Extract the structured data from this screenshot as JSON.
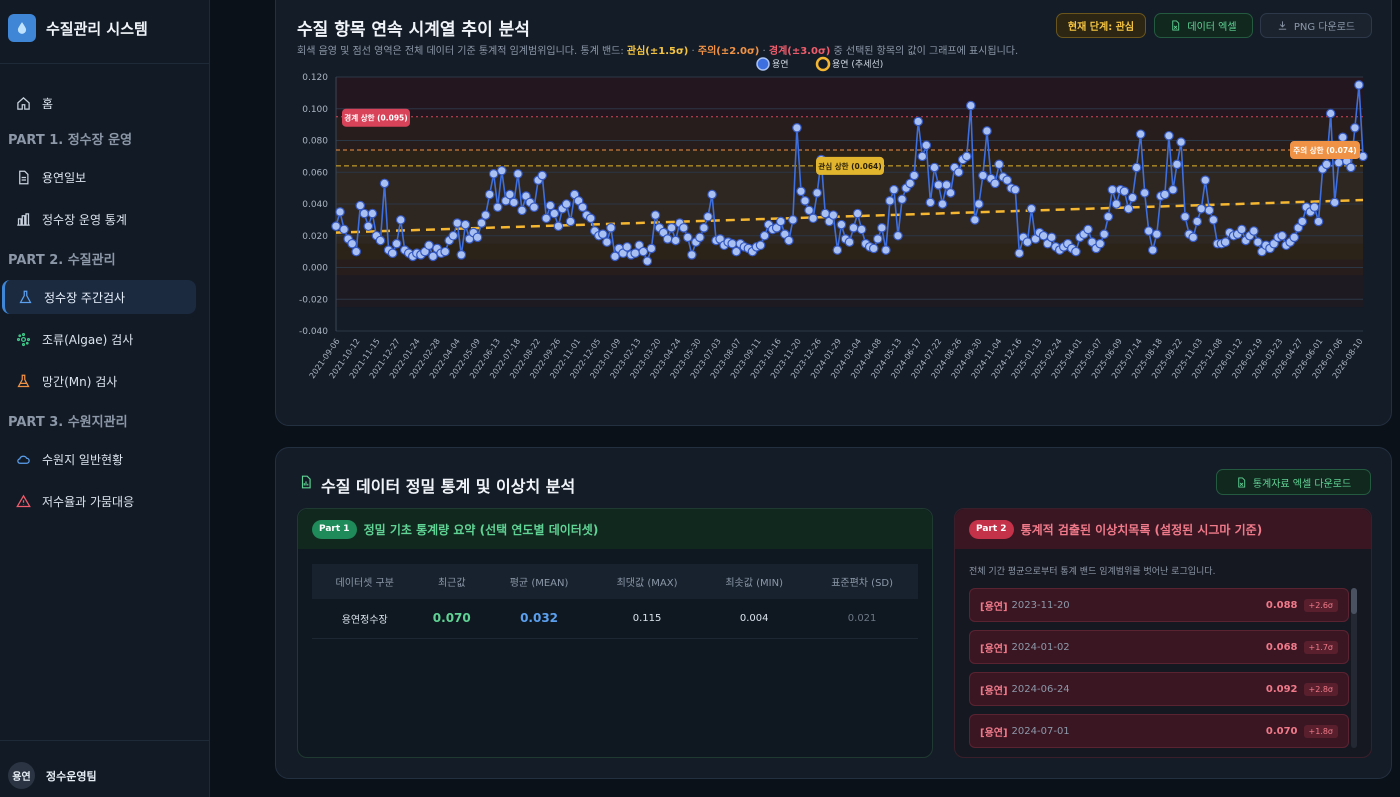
{
  "sidebar": {
    "brand": "수질관리 시스템",
    "home": "홈",
    "part1": "PART 1. 정수장 운영",
    "part1_items": [
      "용연일보",
      "정수장 운영 통계"
    ],
    "part2": "PART 2. 수질관리",
    "part2_items": [
      "정수장 주간검사",
      "조류(Algae) 검사",
      "망간(Mn) 검사"
    ],
    "part3": "PART 3. 수원지관리",
    "part3_items": [
      "수원지 일반현황",
      "저수율과 가뭄대응"
    ],
    "user_avatar": "용연",
    "user_name": "정수운영팀"
  },
  "chart_card": {
    "title": "수질 항목 연속 시계열 추이 분석",
    "subtitle_pre": "회색 음영 및 점선 영역은 전체 데이터 기준 통계적 임계범위입니다. 통계 밴드: ",
    "band1": "관심(±1.5σ)",
    "band2": "주의(±2.0σ)",
    "band3": "경계(±3.0σ)",
    "subtitle_post": " 중 선택된 항목의 값이 그래프에 표시됩니다.",
    "sep": " · ",
    "stage_badge": "현재 단계: 관심",
    "excel_button": "데이터 엑셀",
    "png_button": "PNG 다운로드"
  },
  "chart_data": {
    "type": "line",
    "legend": [
      "용연",
      "용연 (추세선)"
    ],
    "ylim": [
      -0.04,
      0.12
    ],
    "yticks": [
      "0.120",
      "0.100",
      "0.080",
      "0.060",
      "0.040",
      "0.020",
      "0.000",
      "-0.020",
      "-0.040"
    ],
    "xticks": [
      "2021-09-06",
      "2021-10-12",
      "2021-11-15",
      "2021-12-27",
      "2022-01-24",
      "2022-02-28",
      "2022-04-04",
      "2022-05-09",
      "2022-06-13",
      "2022-07-18",
      "2022-08-22",
      "2022-09-26",
      "2022-11-01",
      "2022-12-05",
      "2023-01-09",
      "2023-02-13",
      "2023-03-20",
      "2023-04-24",
      "2023-05-30",
      "2023-07-03",
      "2023-08-07",
      "2023-09-11",
      "2023-10-16",
      "2023-11-20",
      "2023-12-26",
      "2024-01-29",
      "2024-03-04",
      "2024-04-08",
      "2024-05-13",
      "2024-06-17",
      "2024-07-22",
      "2024-08-26",
      "2024-09-30",
      "2024-11-04",
      "2024-12-16",
      "2025-01-13",
      "2025-02-24",
      "2025-04-01",
      "2025-05-07",
      "2025-06-09",
      "2025-07-14",
      "2025-08-18",
      "2025-09-22",
      "2025-11-03",
      "2025-12-08",
      "2026-01-12",
      "2026-02-19",
      "2026-03-23",
      "2026-04-27",
      "2026-06-01",
      "2026-07-06",
      "2026-08-10"
    ],
    "series": [
      {
        "name": "용연",
        "values": [
          0.026,
          0.035,
          0.024,
          0.018,
          0.015,
          0.01,
          0.039,
          0.034,
          0.026,
          0.034,
          0.02,
          0.017,
          0.053,
          0.011,
          0.009,
          0.015,
          0.03,
          0.011,
          0.009,
          0.007,
          0.009,
          0.008,
          0.01,
          0.014,
          0.007,
          0.012,
          0.009,
          0.01,
          0.017,
          0.02,
          0.028,
          0.008,
          0.027,
          0.018,
          0.022,
          0.019,
          0.028,
          0.033,
          0.046,
          0.059,
          0.038,
          0.061,
          0.042,
          0.046,
          0.041,
          0.059,
          0.036,
          0.045,
          0.041,
          0.038,
          0.055,
          0.058,
          0.031,
          0.039,
          0.034,
          0.026,
          0.037,
          0.04,
          0.029,
          0.046,
          0.042,
          0.038,
          0.033,
          0.031,
          0.023,
          0.02,
          0.021,
          0.016,
          0.025,
          0.007,
          0.012,
          0.009,
          0.013,
          0.008,
          0.009,
          0.014,
          0.01,
          0.004,
          0.012,
          0.033,
          0.025,
          0.022,
          0.018,
          0.025,
          0.017,
          0.028,
          0.025,
          0.019,
          0.008,
          0.016,
          0.019,
          0.025,
          0.032,
          0.046,
          0.017,
          0.018,
          0.014,
          0.016,
          0.015,
          0.01,
          0.015,
          0.013,
          0.012,
          0.01,
          0.013,
          0.014,
          0.02,
          0.027,
          0.024,
          0.025,
          0.029,
          0.021,
          0.017,
          0.03,
          0.088,
          0.048,
          0.042,
          0.036,
          0.031,
          0.047,
          0.068,
          0.034,
          0.029,
          0.033,
          0.011,
          0.027,
          0.018,
          0.016,
          0.025,
          0.034,
          0.024,
          0.015,
          0.013,
          0.012,
          0.018,
          0.025,
          0.011,
          0.042,
          0.049,
          0.02,
          0.043,
          0.05,
          0.053,
          0.058,
          0.092,
          0.07,
          0.077,
          0.041,
          0.063,
          0.052,
          0.04,
          0.052,
          0.047,
          0.063,
          0.06,
          0.068,
          0.07,
          0.102,
          0.03,
          0.04,
          0.058,
          0.086,
          0.056,
          0.053,
          0.065,
          0.057,
          0.055,
          0.05,
          0.049,
          0.009,
          0.019,
          0.016,
          0.037,
          0.018,
          0.022,
          0.02,
          0.015,
          0.019,
          0.013,
          0.011,
          0.013,
          0.015,
          0.012,
          0.01,
          0.019,
          0.021,
          0.024,
          0.016,
          0.012,
          0.015,
          0.021,
          0.032,
          0.049,
          0.04,
          0.049,
          0.048,
          0.037,
          0.044,
          0.063,
          0.084,
          0.047,
          0.023,
          0.011,
          0.021,
          0.045,
          0.046,
          0.083,
          0.049,
          0.065,
          0.079,
          0.032,
          0.021,
          0.019,
          0.029,
          0.037,
          0.055,
          0.036,
          0.03,
          0.015,
          0.015,
          0.016,
          0.022,
          0.02,
          0.021,
          0.024,
          0.017,
          0.02,
          0.023,
          0.016,
          0.01,
          0.014,
          0.012,
          0.015,
          0.019,
          0.02,
          0.014,
          0.016,
          0.019,
          0.025,
          0.029,
          0.038,
          0.035,
          0.038,
          0.029,
          0.062,
          0.065,
          0.097,
          0.041,
          0.066,
          0.082,
          0.067,
          0.063,
          0.088,
          0.115,
          0.07
        ]
      }
    ],
    "trend": [
      0.022,
      0.0425
    ],
    "bands": {
      "warning_upper": "경계 상한 (0.095)",
      "caution_upper": "주의 상한 (0.074)",
      "interest_upper": "관심 상한 (0.064)"
    },
    "band_values": {
      "warning": 0.095,
      "caution": 0.074,
      "interest": 0.064
    },
    "colors": {
      "line": "#3d6fe0",
      "trend": "#f5b731",
      "warning": "#d9435a",
      "caution": "#f09245",
      "interest": "#e1b52d"
    }
  },
  "stats_card": {
    "title": "수질 데이터 정밀 통계 및 이상치 분석",
    "download_button": "통계자료 엑셀 다운로드",
    "part1_pill": "Part 1",
    "part1_title": "정밀 기초 통계량 요약 (선택 연도별 데이터셋)",
    "table_headers": [
      "데이터셋 구분",
      "최근값",
      "평균 (MEAN)",
      "최댓값 (MAX)",
      "최솟값 (MIN)",
      "표준편차 (SD)"
    ],
    "table_row": [
      "용연정수장",
      "0.070",
      "0.032",
      "0.115",
      "0.004",
      "0.021"
    ],
    "part2_pill": "Part 2",
    "part2_title": "통계적 검출된 이상치목록 (설정된 시그마 기준)",
    "part2_desc": "전체 기간 평균으로부터 통계 밴드 임계범위를 벗어난 로그입니다.",
    "anomalies": [
      {
        "name": "[용연]",
        "date": "2023-11-20",
        "value": "0.088",
        "sigma": "+2.6σ"
      },
      {
        "name": "[용연]",
        "date": "2024-01-02",
        "value": "0.068",
        "sigma": "+1.7σ"
      },
      {
        "name": "[용연]",
        "date": "2024-06-24",
        "value": "0.092",
        "sigma": "+2.8σ"
      },
      {
        "name": "[용연]",
        "date": "2024-07-01",
        "value": "0.070",
        "sigma": "+1.8σ"
      }
    ]
  }
}
